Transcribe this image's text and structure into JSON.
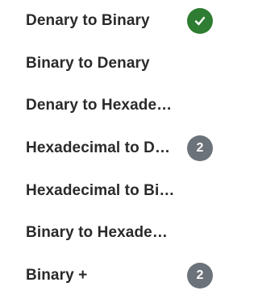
{
  "menu": {
    "items": [
      {
        "label": "Denary to Binary",
        "status": "complete"
      },
      {
        "label": "Binary to Denary"
      },
      {
        "label": "Denary to Hexadecimal"
      },
      {
        "label": "Hexadecimal to De...",
        "badge": "2"
      },
      {
        "label": "Hexadecimal to Binary"
      },
      {
        "label": "Binary to Hexadecimal"
      },
      {
        "label": "Binary +",
        "badge": "2"
      }
    ]
  },
  "colors": {
    "complete_badge": "#2e7d32",
    "count_badge": "#6c727a",
    "label_text": "#2a2a2a"
  },
  "icons": {
    "complete": "check-icon"
  }
}
